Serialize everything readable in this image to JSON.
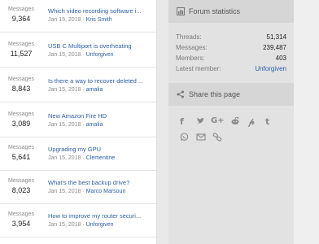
{
  "threads": [
    {
      "stat_label": "Messages",
      "stat_value": "9,364",
      "title": "Which video recording software i...",
      "date": "Jan 15, 2018",
      "author": "Kris Smith"
    },
    {
      "stat_label": "Messages",
      "stat_value": "11,527",
      "title": "USB C Multiport is overheating",
      "date": "Jan 15, 2018",
      "author": "Unforgiven"
    },
    {
      "stat_label": "Messages",
      "stat_value": "8,843",
      "title": "Is there a way to recover deleted ...",
      "date": "Jan 15, 2018",
      "author": "amalia"
    },
    {
      "stat_label": "Messages",
      "stat_value": "3,089",
      "title": "New Amazon Fire HD",
      "date": "Jan 15, 2018",
      "author": "amalia"
    },
    {
      "stat_label": "Messages",
      "stat_value": "5,641",
      "title": "Upgrading my GPU",
      "date": "Jan 15, 2018",
      "author": "Clementine"
    },
    {
      "stat_label": "Messages",
      "stat_value": "8,023",
      "title": "What's the best backup drive?",
      "date": "Jan 15, 2018",
      "author": "Marco Marsoun"
    },
    {
      "stat_label": "Messages",
      "stat_value": "3,954",
      "title": "How to improve my router securi...",
      "date": "Jan 15, 2018",
      "author": "Unforgiven"
    }
  ],
  "forum_statistics": {
    "title": "Forum statistics",
    "rows": [
      {
        "label": "Threads:",
        "value": "51,314"
      },
      {
        "label": "Messages:",
        "value": "239,487"
      },
      {
        "label": "Members:",
        "value": "403"
      },
      {
        "label": "Latest member:",
        "value": "Unforgiven"
      }
    ]
  },
  "share": {
    "title": "Share this page",
    "icons": [
      "facebook-icon",
      "twitter-icon",
      "google-plus-icon",
      "reddit-icon",
      "pinterest-icon",
      "tumblr-icon",
      "whatsapp-icon",
      "email-icon",
      "link-icon"
    ]
  },
  "colors": {
    "link": "#2b5fa8",
    "muted": "#8a8a8a",
    "sidebar_bg": "#e2e2e2"
  }
}
